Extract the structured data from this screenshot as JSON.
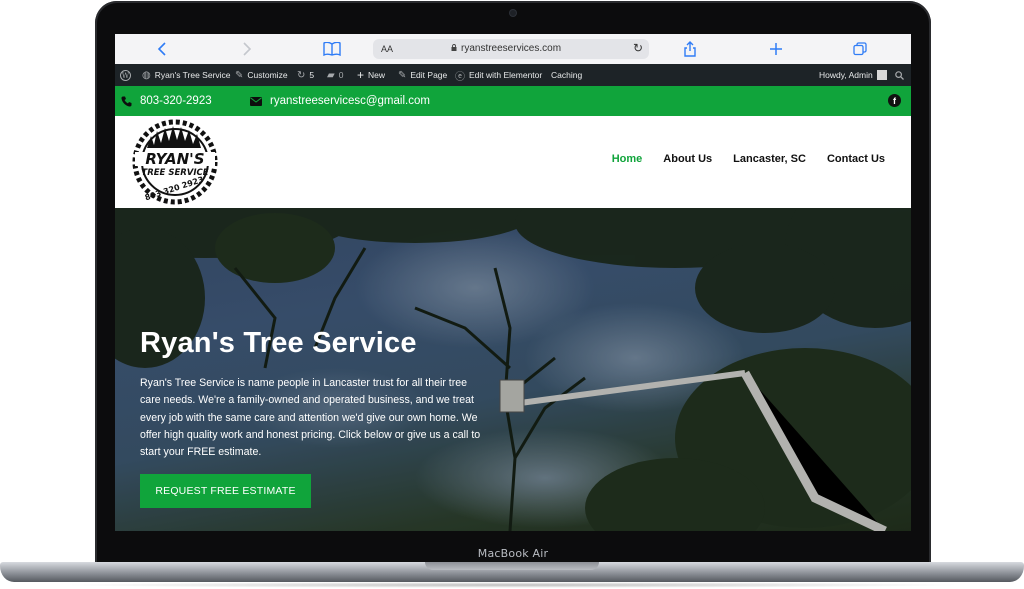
{
  "device": {
    "label": "MacBook Air"
  },
  "browser": {
    "text_size_label": "AA",
    "url": "ryanstreeservices.com"
  },
  "admin_bar": {
    "site_name": "Ryan's Tree Service",
    "customize": "Customize",
    "updates_count": "5",
    "comments_count": "0",
    "new": "New",
    "edit_page": "Edit Page",
    "edit_elementor": "Edit with Elementor",
    "caching": "Caching",
    "howdy": "Howdy, Admin"
  },
  "topbar": {
    "phone": "803-320-2923",
    "email": "ryanstreeservicesc@gmail.com",
    "social_icon": "facebook-icon"
  },
  "logo": {
    "line1": "RYAN'S",
    "line2": "TREE SERVICE",
    "line3": "803 320 2923"
  },
  "nav": {
    "items": [
      "Home",
      "About Us",
      "Lancaster, SC",
      "Contact Us"
    ],
    "active": "Home"
  },
  "hero": {
    "title": "Ryan's Tree Service",
    "paragraph": "Ryan's Tree Service is name people in Lancaster trust for all their tree care needs. We're a family-owned and operated business, and we treat every job with the same care and attention we'd give our own home.  We offer high quality work and honest pricing.  Click below or give us a call to start your FREE estimate.",
    "cta_label": "REQUEST FREE ESTIMATE"
  },
  "colors": {
    "brand_green": "#10a43b",
    "admin_bar": "#1d2327",
    "safari_blue": "#2f7cf6"
  }
}
